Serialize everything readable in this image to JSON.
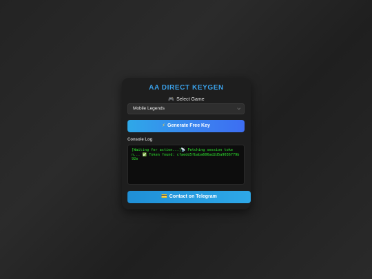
{
  "app": {
    "title": "AA DIRECT KEYGEN"
  },
  "game_select": {
    "icon": "gamepad-icon",
    "icon_glyph": "🎮",
    "label": "Select Game",
    "selected": "Mobile Legends"
  },
  "generate_button": {
    "icon": "lightning-icon",
    "icon_glyph": "⚡",
    "label": "Generate Free Key"
  },
  "console": {
    "label": "Console Log",
    "text": "[Waiting for action...]📡 Fetching session token... ✅ Token found: cfaedd5fbaba606ad2d5a9036779b92e"
  },
  "telegram_button": {
    "icon": "telegram-icon",
    "icon_glyph": "💳",
    "label": "Contact on Telegram"
  },
  "colors": {
    "accent": "#3aa0e8",
    "console_text": "#2ee82e",
    "card_bg": "#1e1e1e"
  }
}
